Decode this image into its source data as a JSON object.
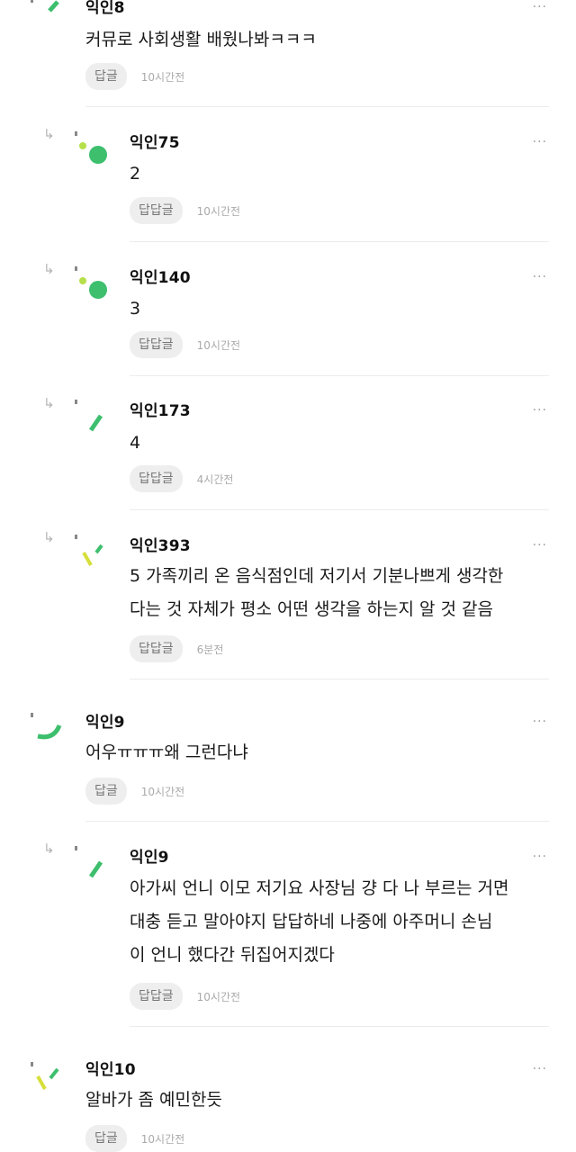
{
  "comments": [
    {
      "name": "익인8",
      "lines": [
        "커뮤로 사회생활 배웠나봐ㅋㅋㅋ"
      ],
      "reply_label": "답글",
      "time": "10시간전",
      "avatar": "green-stick",
      "more": "..."
    },
    {
      "name": "익인75",
      "lines": [
        "2"
      ],
      "reply_label": "답답글",
      "time": "10시간전",
      "avatar": "green-dots",
      "more": "..."
    },
    {
      "name": "익인140",
      "lines": [
        "3"
      ],
      "reply_label": "답답글",
      "time": "10시간전",
      "avatar": "green-dots",
      "more": "..."
    },
    {
      "name": "익인173",
      "lines": [
        "4"
      ],
      "reply_label": "답답글",
      "time": "4시간전",
      "avatar": "green-stick",
      "more": "..."
    },
    {
      "name": "익인393",
      "lines": [
        "5 가족끼리 온 음식점인데 저기서 기분나쁘게 생각한",
        "다는 것 자체가 평소 어떤 생각을 하는지 알 것 같음"
      ],
      "reply_label": "답답글",
      "time": "6분전",
      "avatar": "yellow-green-sticks",
      "more": "..."
    },
    {
      "name": "익인9",
      "lines": [
        "어우ㅠㅠㅠ왜 그런다냐"
      ],
      "reply_label": "답글",
      "time": "10시간전",
      "avatar": "green-arc",
      "more": "..."
    },
    {
      "name": "익인9",
      "lines": [
        "아가씨 언니 이모 저기요 사장님 걍 다 나 부르는 거면",
        "대충 듣고 말아야지 답답하네 나중에 아주머니 손님",
        "이 언니 했다간 뒤집어지겠다"
      ],
      "reply_label": "답답글",
      "time": "10시간전",
      "avatar": "green-stick",
      "more": "..."
    },
    {
      "name": "익인10",
      "lines": [
        "알바가 좀 예민한듯"
      ],
      "reply_label": "답글",
      "time": "10시간전",
      "avatar": "yellow-green-sticks",
      "more": "..."
    }
  ],
  "reply_arrow_icon": "↳",
  "colors": {
    "green": "#3dbf6e",
    "yellow": "#d6df3a",
    "divider": "#ececec"
  }
}
